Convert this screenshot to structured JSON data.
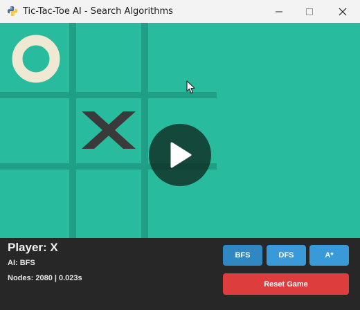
{
  "window": {
    "title": "Tic-Tac-Toe AI - Search Algorithms"
  },
  "board": {
    "cells": [
      [
        "O",
        "",
        ""
      ],
      [
        "",
        "X",
        ""
      ],
      [
        "",
        "",
        ""
      ]
    ]
  },
  "panel": {
    "player_label": "Player: X",
    "ai_label": "AI: BFS",
    "nodes_label": "Nodes: 2080 | 0.023s",
    "buttons": {
      "bfs": "BFS",
      "dfs": "DFS",
      "astar": "A*",
      "reset": "Reset Game"
    }
  },
  "colors": {
    "board_bg": "#29bb9d",
    "grid": "#1f9f86",
    "o_mark": "#efe8d2",
    "x_mark": "#3a3a3a",
    "panel_bg": "#272727",
    "bfs_active": "#2f88c2",
    "algo_btn": "#3a9ad9",
    "reset_btn": "#de3d3d"
  },
  "icons": {
    "app": "python-icon",
    "minimize": "minimize-icon",
    "maximize": "maximize-icon",
    "close": "close-icon",
    "play": "play-icon",
    "cursor": "mouse-cursor-icon"
  }
}
